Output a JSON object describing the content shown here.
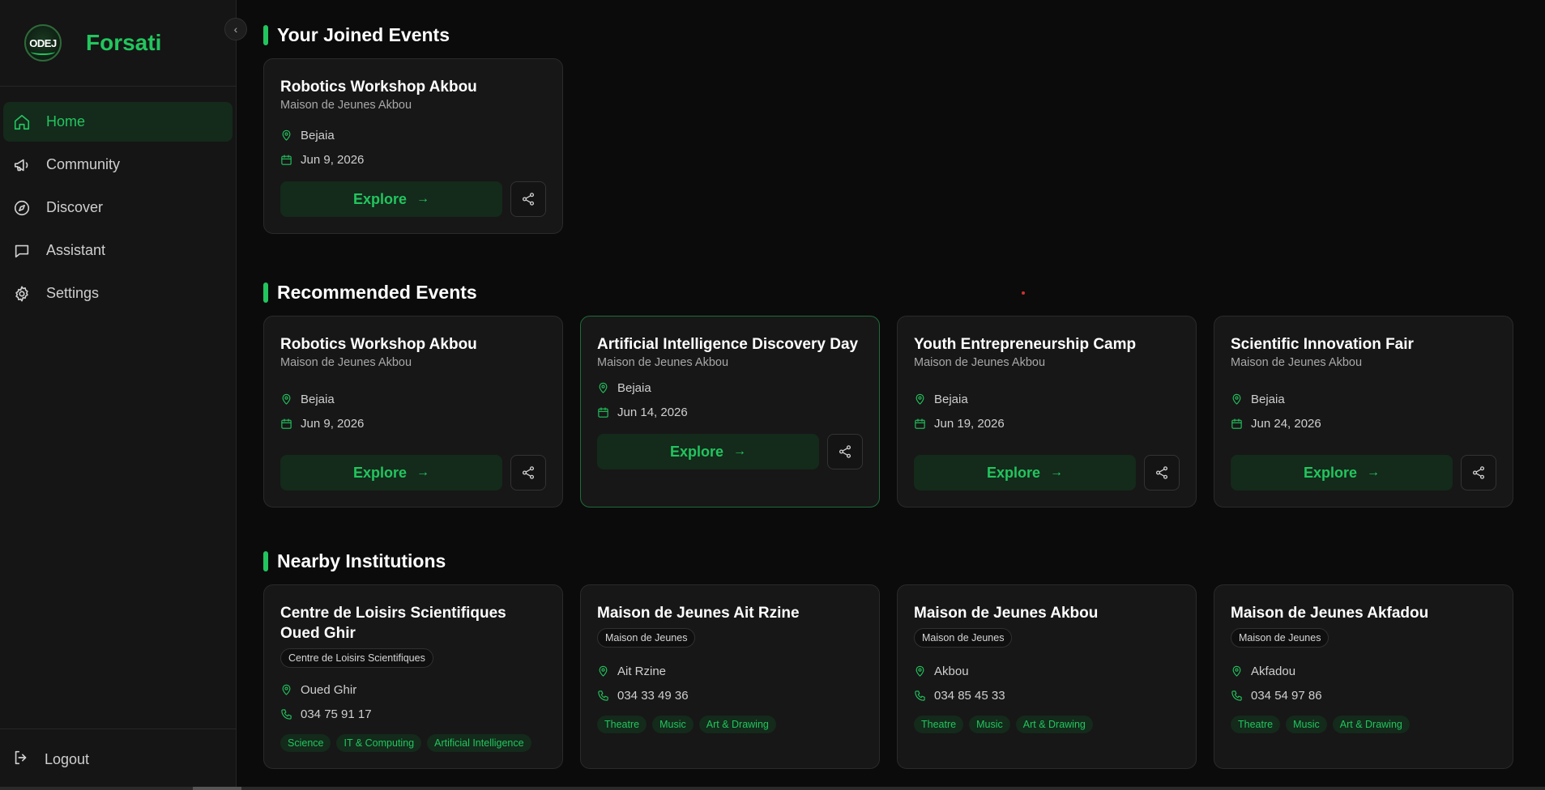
{
  "app": {
    "brand": "Forsati",
    "logo_text": "ODEJ"
  },
  "sidebar": {
    "items": [
      {
        "label": "Home",
        "icon": "home-icon",
        "active": true
      },
      {
        "label": "Community",
        "icon": "megaphone-icon",
        "active": false
      },
      {
        "label": "Discover",
        "icon": "compass-icon",
        "active": false
      },
      {
        "label": "Assistant",
        "icon": "chat-icon",
        "active": false
      },
      {
        "label": "Settings",
        "icon": "gear-icon",
        "active": false
      }
    ],
    "logout_label": "Logout"
  },
  "joined": {
    "title": "Your Joined Events",
    "events": [
      {
        "title": "Robotics Workshop Akbou",
        "venue": "Maison de Jeunes Akbou",
        "location": "Bejaia",
        "date": "Jun 9, 2026",
        "cta": "Explore"
      }
    ]
  },
  "recommended": {
    "title": "Recommended Events",
    "events": [
      {
        "title": "Robotics Workshop Akbou",
        "venue": "Maison de Jeunes Akbou",
        "location": "Bejaia",
        "date": "Jun 9, 2026",
        "cta": "Explore"
      },
      {
        "title": "Artificial Intelligence Discovery Day",
        "venue": "Maison de Jeunes Akbou",
        "location": "Bejaia",
        "date": "Jun 14, 2026",
        "cta": "Explore"
      },
      {
        "title": "Youth Entrepreneurship Camp",
        "venue": "Maison de Jeunes Akbou",
        "location": "Bejaia",
        "date": "Jun 19, 2026",
        "cta": "Explore"
      },
      {
        "title": "Scientific Innovation Fair",
        "venue": "Maison de Jeunes Akbou",
        "location": "Bejaia",
        "date": "Jun 24, 2026",
        "cta": "Explore"
      }
    ]
  },
  "nearby": {
    "title": "Nearby Institutions",
    "institutions": [
      {
        "name": "Centre de Loisirs Scientifiques Oued Ghir",
        "type": "Centre de Loisirs Scientifiques",
        "location": "Oued Ghir",
        "phone": "034 75 91 17",
        "tags": [
          "Science",
          "IT & Computing",
          "Artificial Intelligence"
        ]
      },
      {
        "name": "Maison de Jeunes Ait Rzine",
        "type": "Maison de Jeunes",
        "location": "Ait Rzine",
        "phone": "034 33 49 36",
        "tags": [
          "Theatre",
          "Music",
          "Art & Drawing"
        ]
      },
      {
        "name": "Maison de Jeunes Akbou",
        "type": "Maison de Jeunes",
        "location": "Akbou",
        "phone": "034 85 45 33",
        "tags": [
          "Theatre",
          "Music",
          "Art & Drawing"
        ]
      },
      {
        "name": "Maison de Jeunes Akfadou",
        "type": "Maison de Jeunes",
        "location": "Akfadou",
        "phone": "034 54 97 86",
        "tags": [
          "Theatre",
          "Music",
          "Art & Drawing"
        ]
      }
    ]
  },
  "colors": {
    "accent": "#22c55e",
    "background": "#0b0b0b",
    "card": "#171717",
    "sidebar": "#151515"
  }
}
